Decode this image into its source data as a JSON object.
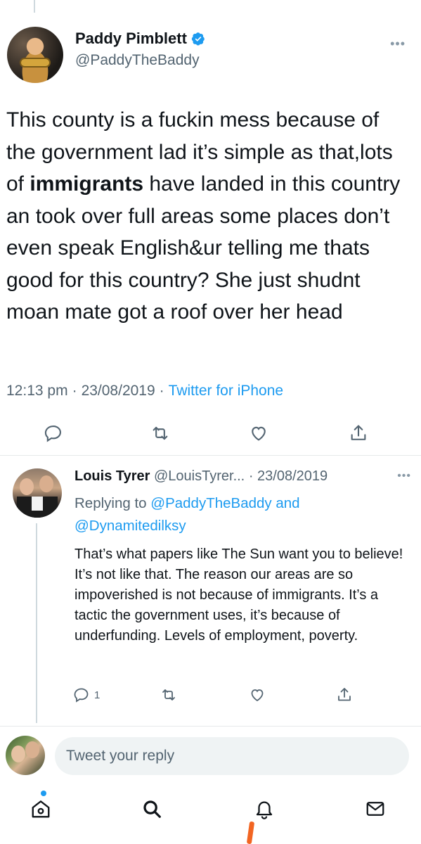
{
  "tweet": {
    "author_name": "Paddy Pimblett",
    "author_handle": "@PaddyTheBaddy",
    "text_before": "This county is a fuckin mess because of the government lad it’s simple as that,lots of ",
    "text_bold": "immigrants",
    "text_after": " have landed in this country an took over full areas some places don’t even speak English&ur telling me thats good for this country? She just shudnt moan mate got a roof over her head",
    "time": "12:13 pm",
    "separator": "·",
    "date": "23/08/2019",
    "source": "Twitter for iPhone",
    "icons": [
      "comment-icon",
      "retweet-icon",
      "like-icon",
      "share-icon"
    ]
  },
  "reply": {
    "author_name": "Louis Tyrer",
    "author_handle": "@LouisTyrer...",
    "separator": "·",
    "date": "23/08/2019",
    "replying_prefix": "Replying to",
    "replying_to_1": "@PaddyTheBaddy",
    "replying_and": "and",
    "replying_to_2": "@Dynamitedilksy",
    "text": "That’s what papers like The Sun want you to believe! It’s not like that. The reason our areas are so impoverished is not because of immigrants. It’s a tactic the government uses, it’s because of underfunding. Levels of employment, poverty.",
    "reply_count": "1"
  },
  "compose": {
    "placeholder": "Tweet your reply"
  },
  "tab_bar": {
    "items": [
      "home-icon",
      "search-icon",
      "notifications-icon",
      "messages-icon"
    ]
  },
  "colors": {
    "accent": "#1d9bf0",
    "text": "#0f1419",
    "muted": "#536471"
  }
}
